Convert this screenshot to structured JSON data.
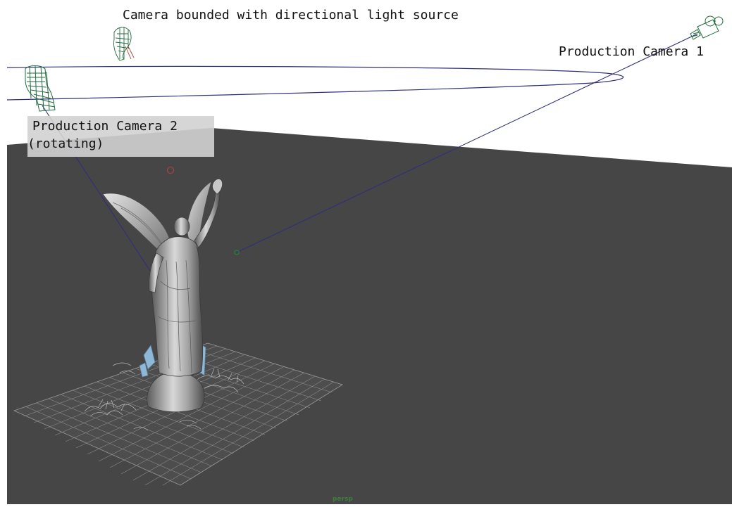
{
  "viewport": {
    "camera_name": "persp",
    "background_upper": "#ffffff",
    "ground_color": "#464646",
    "curve_color": "#2f2f7a",
    "wire_color": "#1f6b3a"
  },
  "annotations": {
    "top_label": "Camera bounded with directional light source",
    "camera1_label": "Production Camera 1",
    "camera2_label_line1": "Production Camera 2",
    "camera2_label_line2": "(rotating)"
  },
  "scene_objects": [
    {
      "name": "angel-statue"
    },
    {
      "name": "ground-grid"
    },
    {
      "name": "production-camera-1-icon"
    },
    {
      "name": "production-camera-2-icon"
    },
    {
      "name": "directional-light-camera-icon"
    }
  ]
}
